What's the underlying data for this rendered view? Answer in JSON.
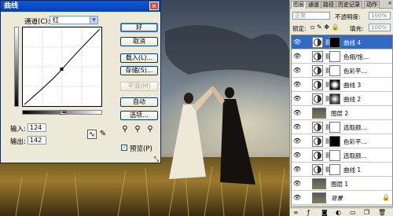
{
  "curves": {
    "title": "曲线",
    "channel_label": "通道(C):",
    "channel_value": "红",
    "input_label": "输入:",
    "input_value": "124",
    "output_label": "输出:",
    "output_value": "142",
    "buttons": [
      "好",
      "取消",
      "载入(L)...",
      "存储(S)...",
      "平滑(M)",
      "自动",
      "选项..."
    ],
    "preview_label": "预览(P)",
    "preview_checked": "✓"
  },
  "layers": {
    "tabs": [
      "图层",
      "通道",
      "路径",
      "历史记录",
      "动作"
    ],
    "blend_mode": "正常",
    "opacity_label": "不透明度:",
    "opacity_value": "100%",
    "lock_label": "锁定:",
    "fill_label": "填充:",
    "fill_value": "100%",
    "items": [
      {
        "name": "曲线 4",
        "type": "adjust",
        "mask": "dark",
        "selected": true
      },
      {
        "name": "色相/饱...",
        "type": "adjust",
        "mask": "white"
      },
      {
        "name": "色彩平...",
        "type": "adjust",
        "mask": "white"
      },
      {
        "name": "曲线 3",
        "type": "adjust",
        "mask": "radial"
      },
      {
        "name": "曲线 2",
        "type": "adjust",
        "mask": "radial-soft"
      },
      {
        "name": "图层 2",
        "type": "photo"
      },
      {
        "name": "选取颜...",
        "type": "adjust",
        "mask": "white"
      },
      {
        "name": "色彩平...",
        "type": "adjust",
        "mask": "dark"
      },
      {
        "name": "选取颜...",
        "type": "adjust",
        "mask": "white"
      },
      {
        "name": "曲线 1",
        "type": "adjust",
        "mask": "white"
      },
      {
        "name": "图层 1",
        "type": "photo"
      },
      {
        "name": "背景",
        "type": "background"
      }
    ]
  }
}
